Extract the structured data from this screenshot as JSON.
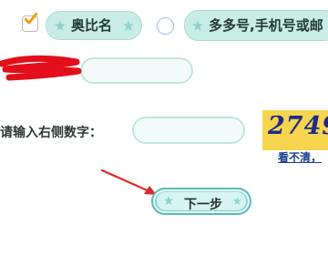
{
  "options": {
    "aobi_label": "奥比名",
    "other_label": "多多号,手机号或邮"
  },
  "form": {
    "captcha_label": "请输入右侧数字：",
    "captcha_image_text": "2749",
    "captcha_unclear_text": "看不清，"
  },
  "buttons": {
    "next_label": "下一步"
  },
  "colors": {
    "accent_mint": "#c9ece5",
    "captcha_background": "#f6d44e",
    "arrow_red": "#e0292c",
    "link_blue": "#1a3f8f"
  }
}
